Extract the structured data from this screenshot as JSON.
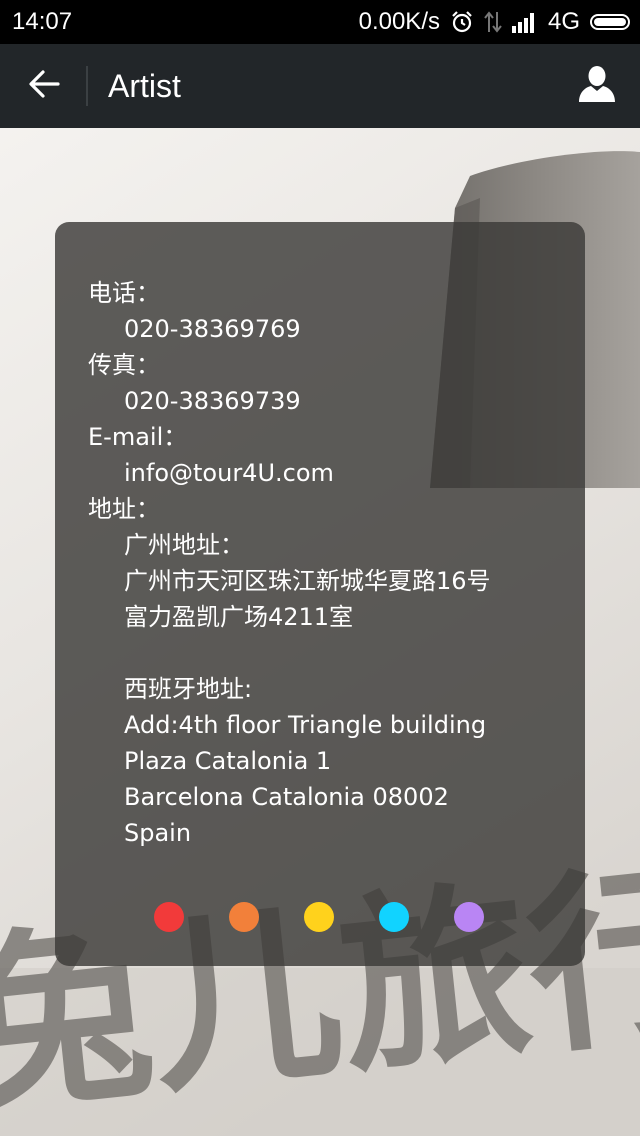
{
  "status_bar": {
    "time": "14:07",
    "speed": "0.00K/s",
    "network": "4G",
    "icons": [
      "alarm-icon",
      "data-arrows-icon",
      "signal-icon",
      "battery-icon"
    ]
  },
  "action_bar": {
    "title": "Artist",
    "back_icon": "back-arrow-icon",
    "user_icon": "user-icon"
  },
  "contact": {
    "phone_label": "电话：",
    "phone_value": "020-38369769",
    "fax_label": "传真：",
    "fax_value": "020-38369739",
    "email_label": "E-mail：",
    "email_value": "info@tour4U.com",
    "address_label": "地址：",
    "guangzhou_label": "广州地址：",
    "guangzhou_line1": "广州市天河区珠江新城华夏路16号",
    "guangzhou_line2": "富力盈凯广场4211室",
    "spain_label": "西班牙地址:",
    "spain_line1": "Add:4th floor Triangle building",
    "spain_line2": "Plaza Catalonia 1",
    "spain_line3": "Barcelona Catalonia 08002",
    "spain_line4": "Spain"
  },
  "color_dots": [
    "#f23a3a",
    "#f2803a",
    "#ffd21c",
    "#11d3ff",
    "#b985f4"
  ],
  "background": {
    "watermark_text": "兔儿旅行"
  }
}
